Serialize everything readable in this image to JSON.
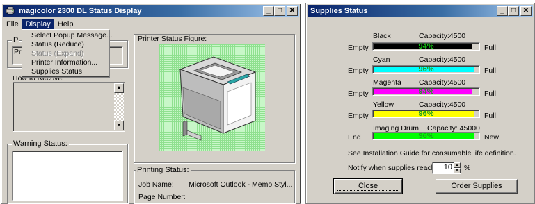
{
  "left_window": {
    "title": "magicolor 2300 DL Status Display",
    "menus": [
      "File",
      "Display",
      "Help"
    ],
    "display_menu": [
      {
        "label": "Select Popup Message...",
        "enabled": true
      },
      {
        "label": "Status (Reduce)",
        "enabled": true
      },
      {
        "label": "Status (Expand)",
        "enabled": false
      },
      {
        "label": "Printer Information...",
        "enabled": true
      },
      {
        "label": "Supplies Status",
        "enabled": true
      }
    ],
    "partial_labels": {
      "group_top": "P",
      "inner_top": "Pr"
    },
    "how_to_recover_label": "How to Recover:",
    "warning_status_label": "Warning Status:",
    "printer_figure_label": "Printer Status Figure:",
    "printing_status": {
      "label": "Printing Status:",
      "job_name_label": "Job Name:",
      "job_name_value": "Microsoft Outlook - Memo Styl...",
      "page_number_label": "Page Number:"
    }
  },
  "supplies_window": {
    "title": "Supplies Status",
    "items": [
      {
        "name": "Black",
        "capacity": "Capacity:4500",
        "percent": "94%",
        "level": 0.94,
        "color": "#000000",
        "text_color": "#13c913",
        "low_label": "Empty",
        "high_label": "Full"
      },
      {
        "name": "Cyan",
        "capacity": "Capacity:4500",
        "percent": "96%",
        "level": 0.96,
        "color": "#00ffff",
        "text_color": "#1a9e1a",
        "low_label": "Empty",
        "high_label": "Full"
      },
      {
        "name": "Magenta",
        "capacity": "Capacity:4500",
        "percent": "94%",
        "level": 0.94,
        "color": "#ff00ff",
        "text_color": "#1a9e1a",
        "low_label": "Empty",
        "high_label": "Full"
      },
      {
        "name": "Yellow",
        "capacity": "Capacity:4500",
        "percent": "96%",
        "level": 0.96,
        "color": "#ffff00",
        "text_color": "#1a9e1a",
        "low_label": "Empty",
        "high_label": "Full"
      },
      {
        "name": "Imaging Drum",
        "capacity": "Capacity: 45000",
        "percent": "96%",
        "level": 0.96,
        "color": "#00ff00",
        "text_color": "#1a9e1a",
        "low_label": "End",
        "high_label": "New"
      }
    ],
    "install_note": "See Installation Guide for consumable life definition.",
    "notify_label": "Notify when supplies reach",
    "notify_value": "10",
    "notify_unit": "%",
    "close_label": "Close",
    "order_label": "Order Supplies"
  }
}
